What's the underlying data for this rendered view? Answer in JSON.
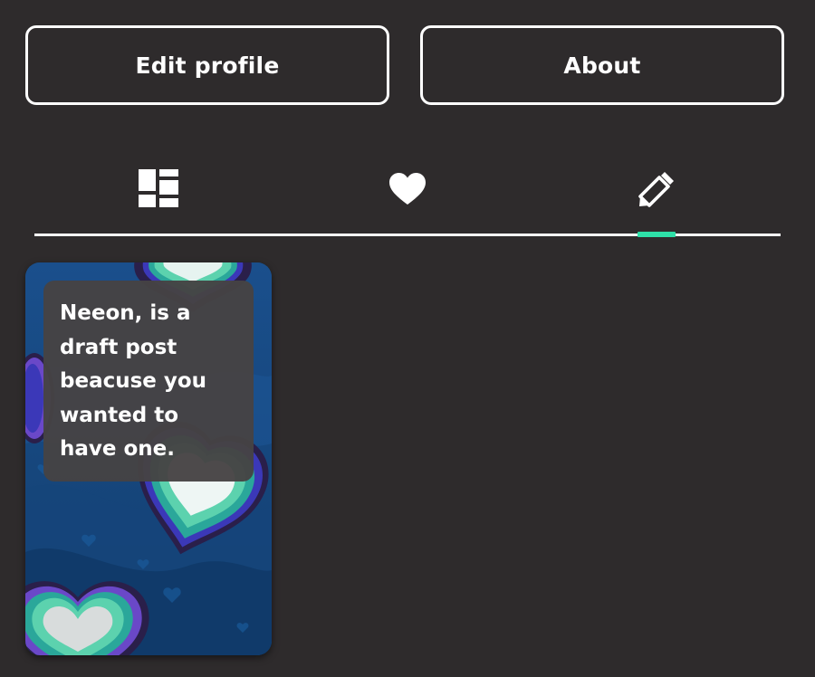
{
  "profile_actions": {
    "edit_profile_label": "Edit profile",
    "about_label": "About"
  },
  "tabs": [
    {
      "icon": "grid-icon",
      "active": false
    },
    {
      "icon": "heart-icon",
      "active": false
    },
    {
      "icon": "pencil-icon",
      "active": true
    }
  ],
  "colors": {
    "background": "#2e2b2c",
    "active_tab_indicator": "#2ee0a8",
    "card_background": "#14457a",
    "text": "#ffffff"
  },
  "drafts": [
    {
      "text": "Neeon, is a draft post beacuse you wanted to have one.",
      "background_theme": "neon-hearts"
    }
  ]
}
